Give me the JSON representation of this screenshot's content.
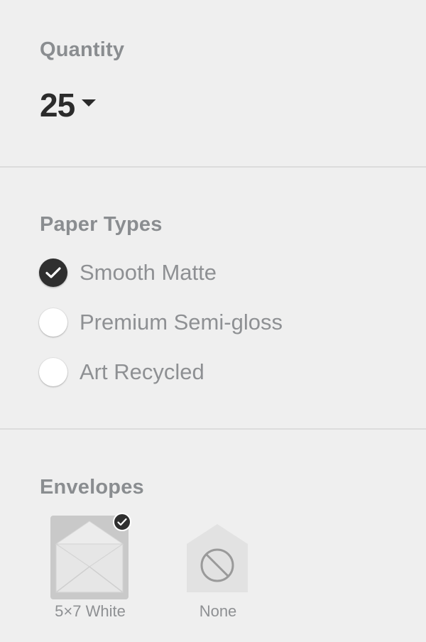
{
  "quantity": {
    "title": "Quantity",
    "value": "25"
  },
  "paper_types": {
    "title": "Paper Types",
    "options": [
      {
        "label": "Smooth Matte",
        "selected": true
      },
      {
        "label": "Premium Semi-gloss",
        "selected": false
      },
      {
        "label": "Art Recycled",
        "selected": false
      }
    ]
  },
  "envelopes": {
    "title": "Envelopes",
    "options": [
      {
        "label": "5×7 White",
        "selected": true,
        "icon": "envelope-icon"
      },
      {
        "label": "None",
        "selected": false,
        "icon": "prohibited-icon"
      }
    ]
  },
  "colors": {
    "background": "#efefef",
    "heading": "#8a8d90",
    "selected": "#2f2f2f",
    "divider": "#dcdcdc"
  }
}
